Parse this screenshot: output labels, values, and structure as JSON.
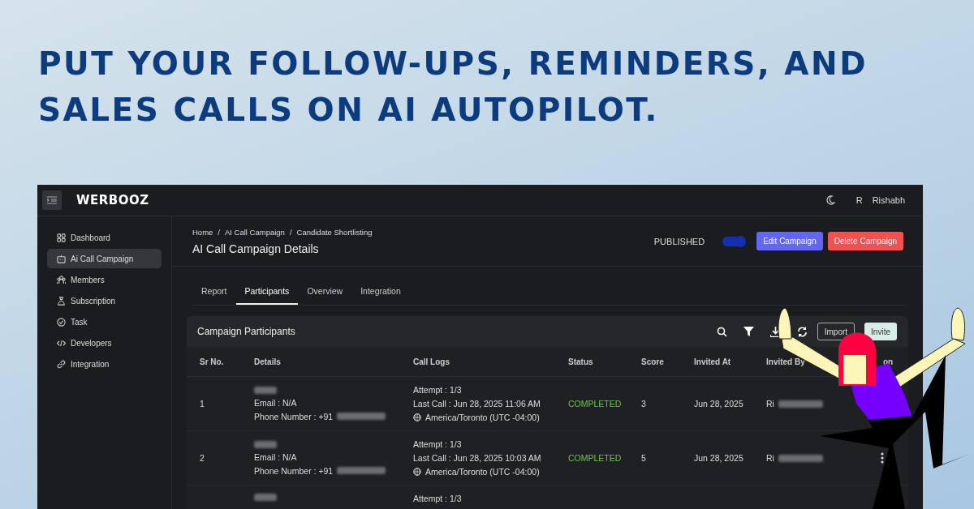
{
  "headline": [
    "PUT YOUR FOLLOW-UPS, REMINDERS, AND",
    "SALES CALLS ON AI AUTOPILOT."
  ],
  "app": {
    "logo": "WERBOOZ",
    "user_initial": "R",
    "user_name": "Rishabh"
  },
  "sidebar": {
    "items": [
      {
        "label": "Dashboard",
        "selected": false
      },
      {
        "label": "Ai Call Campaign",
        "selected": true
      },
      {
        "label": "Members",
        "selected": false
      },
      {
        "label": "Subscription",
        "selected": false
      },
      {
        "label": "Task",
        "selected": false
      },
      {
        "label": "Developers",
        "selected": false
      },
      {
        "label": "Integration",
        "selected": false
      }
    ]
  },
  "breadcrumb": [
    "Home",
    "/",
    "AI Call Campaign",
    "/",
    "Candidate Shortlisting"
  ],
  "page_title": "AI Call Campaign Details",
  "published": {
    "label": "PUBLISHED",
    "on": true
  },
  "buttons": [
    {
      "label": "Edit Campaign",
      "kind": "primary"
    },
    {
      "label": "Delete Campaign",
      "kind": "danger"
    }
  ],
  "tabs": [
    {
      "label": "Report",
      "selected": false
    },
    {
      "label": "Participants",
      "selected": true
    },
    {
      "label": "Overview",
      "selected": false
    },
    {
      "label": "Integration",
      "selected": false
    }
  ],
  "card": {
    "title": "Campaign Participants",
    "actions": [
      {
        "label": "Import",
        "kind": "outline"
      },
      {
        "label": "Invite",
        "kind": "filled"
      }
    ]
  },
  "table": {
    "columns": [
      "Sr No.",
      "Details",
      "Call Logs",
      "Status",
      "Score",
      "Invited At",
      "Invited By",
      "on"
    ],
    "rows": [
      {
        "sr": "1",
        "email": "Email : N/A",
        "phone": "Phone Number : +91",
        "attempt": "Attempt : 1/3",
        "last_call": "Last Call : Jun 28, 2025 11:06 AM",
        "timezone": "America/Toronto (UTC -04:00)",
        "status": "COMPLETED",
        "score": "3",
        "invited_at": "Jun 28, 2025",
        "invited_by": "Ri"
      },
      {
        "sr": "2",
        "email": "Email : N/A",
        "phone": "Phone Number : +91",
        "attempt": "Attempt : 1/3",
        "last_call": "Last Call : Jun 28, 2025 10:03 AM",
        "timezone": "America/Toronto (UTC -04:00)",
        "status": "COMPLETED",
        "score": "5",
        "invited_at": "Jun 28, 2025",
        "invited_by": "Ri",
        "menu": true
      },
      {
        "attempt": "Attempt : 1/3"
      }
    ]
  }
}
